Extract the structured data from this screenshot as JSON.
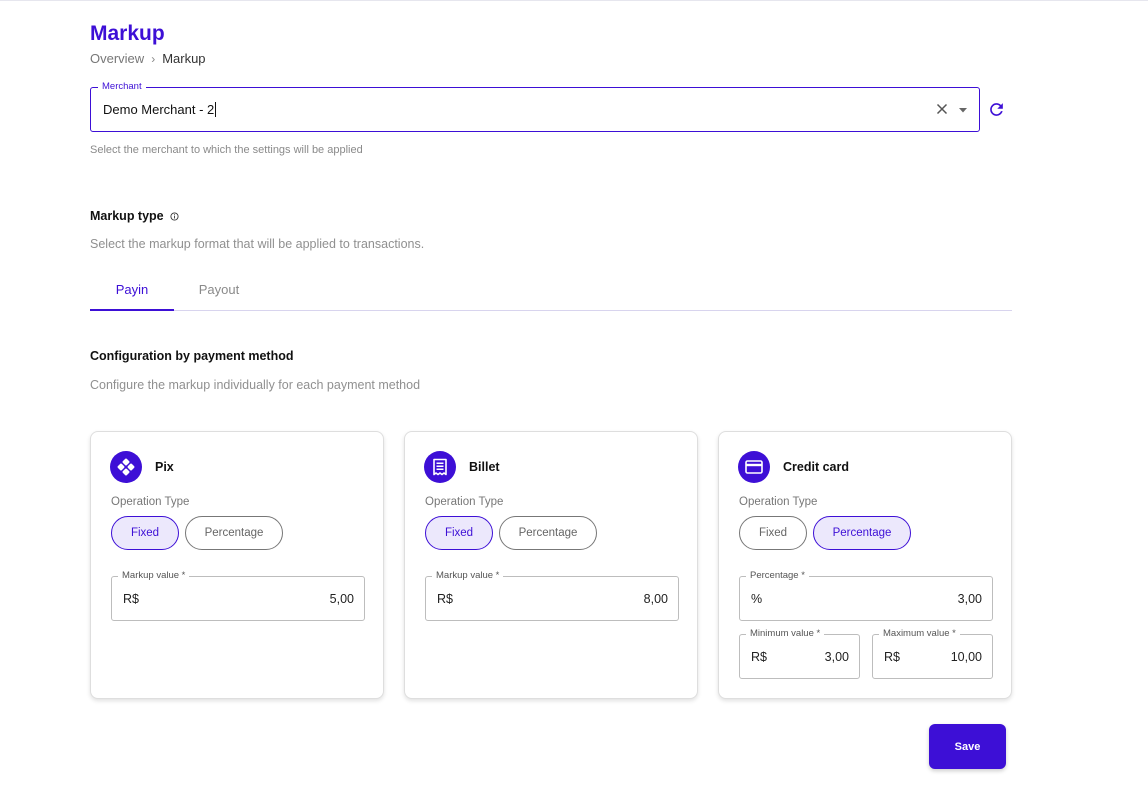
{
  "header": {
    "title": "Markup",
    "breadcrumb": {
      "root": "Overview",
      "separator": "›",
      "current": "Markup"
    }
  },
  "merchant": {
    "label": "Merchant",
    "value": "Demo Merchant - 2",
    "helper": "Select the merchant to which the settings will be applied"
  },
  "markup_type": {
    "title": "Markup type",
    "description": "Select the markup format that will be applied to transactions."
  },
  "tabs": [
    {
      "label": "Payin",
      "active": true
    },
    {
      "label": "Payout",
      "active": false
    }
  ],
  "config": {
    "title": "Configuration by payment method",
    "description": "Configure the markup individually for each payment method"
  },
  "cards": [
    {
      "title": "Pix",
      "icon": "pix-icon",
      "operation_label": "Operation Type",
      "options": [
        "Fixed",
        "Percentage"
      ],
      "selected": "Fixed",
      "fields": [
        {
          "label": "Markup value *",
          "prefix": "R$",
          "value": "5,00"
        }
      ]
    },
    {
      "title": "Billet",
      "icon": "receipt-icon",
      "operation_label": "Operation Type",
      "options": [
        "Fixed",
        "Percentage"
      ],
      "selected": "Fixed",
      "fields": [
        {
          "label": "Markup value *",
          "prefix": "R$",
          "value": "8,00"
        }
      ]
    },
    {
      "title": "Credit card",
      "icon": "credit-card-icon",
      "operation_label": "Operation Type",
      "options": [
        "Fixed",
        "Percentage"
      ],
      "selected": "Percentage",
      "fields": [
        {
          "label": "Percentage *",
          "prefix": "%",
          "value": "3,00"
        },
        {
          "label": "Minimum value *",
          "prefix": "R$",
          "value": "3,00"
        },
        {
          "label": "Maximum value *",
          "prefix": "R$",
          "value": "10,00"
        }
      ]
    }
  ],
  "actions": {
    "save_label": "Save"
  },
  "colors": {
    "accent": "#3d0fd6",
    "accent_light": "#ece8fc"
  }
}
